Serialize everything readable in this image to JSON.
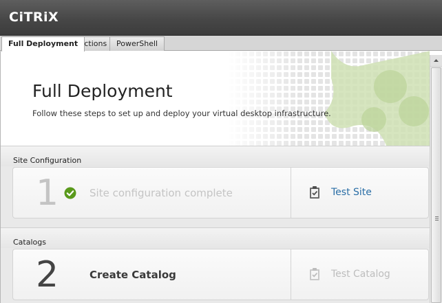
{
  "app": {
    "logo_text": "CiTRiX"
  },
  "tabs": [
    {
      "label": "Full Deployment",
      "active": true
    },
    {
      "label": "Actions",
      "active": false
    },
    {
      "label": "PowerShell",
      "active": false
    }
  ],
  "hero": {
    "title": "Full Deployment",
    "subtitle": "Follow these steps to set up and deploy your virtual desktop infrastructure."
  },
  "sections": [
    {
      "header": "Site Configuration",
      "step": {
        "number": "1",
        "label": "Site configuration complete",
        "status": "complete",
        "status_icon": "check-circle-icon",
        "test_link": "Test Site",
        "test_enabled": true
      }
    },
    {
      "header": "Catalogs",
      "step": {
        "number": "2",
        "label": "Create Catalog",
        "status": "pending",
        "test_link": "Test Catalog",
        "test_enabled": false
      }
    }
  ],
  "colors": {
    "accent_link": "#2a6ea6",
    "success": "#5a9a1c",
    "titlebar": "#474747",
    "hero_pattern": "#cfe0b4"
  }
}
